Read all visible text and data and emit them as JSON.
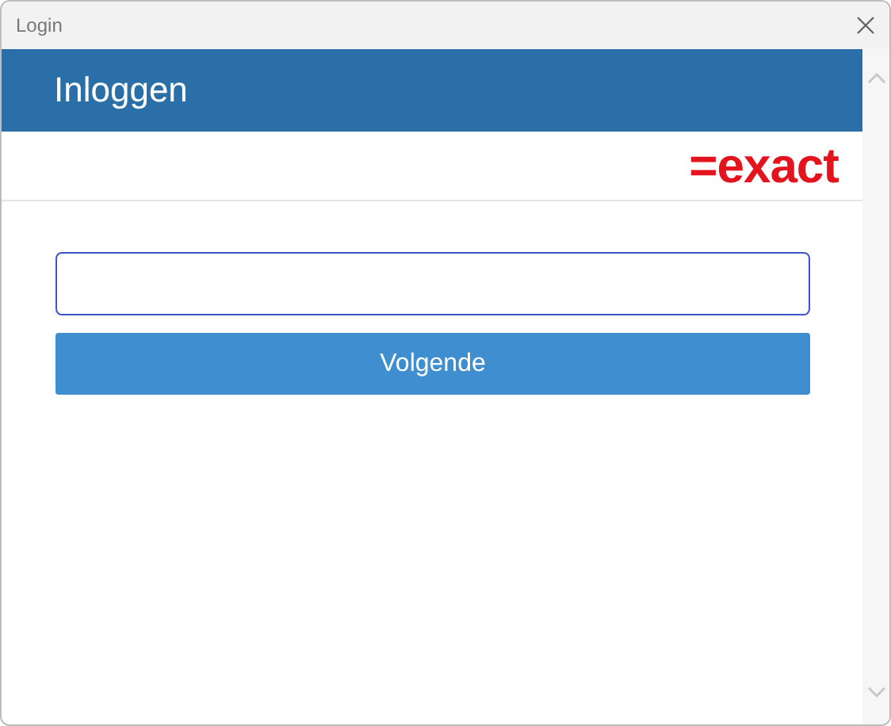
{
  "window": {
    "title": "Login"
  },
  "header": {
    "title": "Inloggen"
  },
  "logo": "=exact",
  "form": {
    "button": "Volgende"
  }
}
